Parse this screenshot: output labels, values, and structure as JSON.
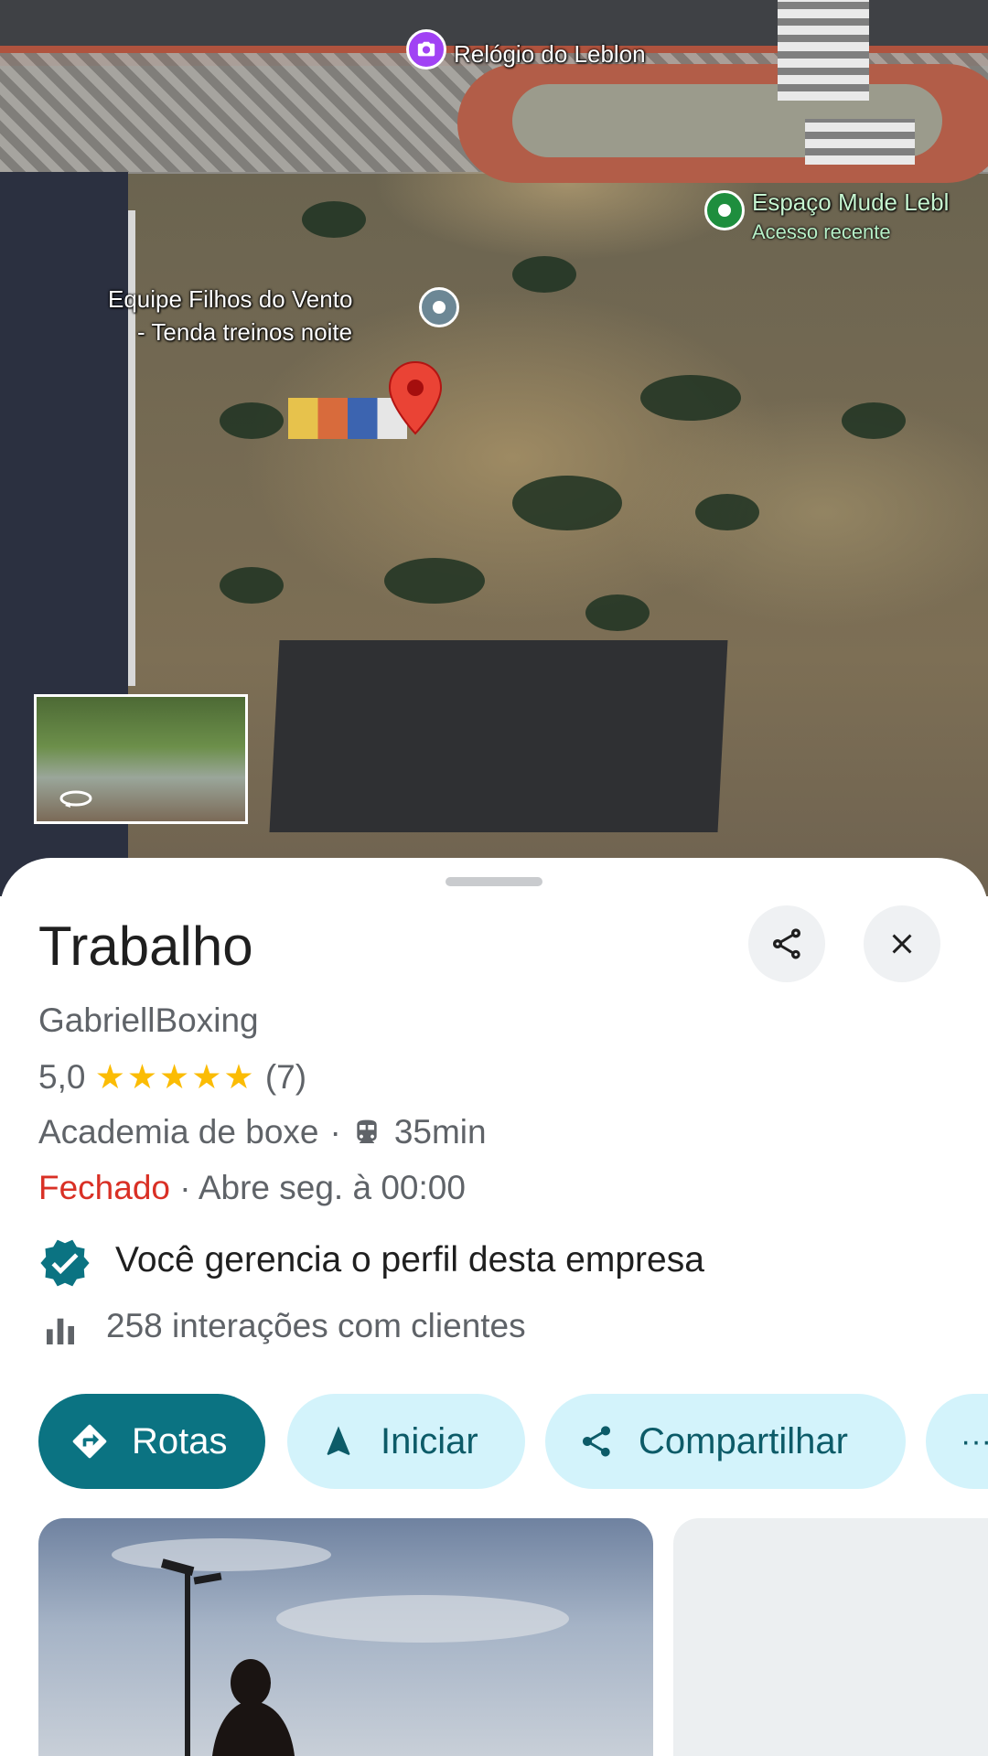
{
  "map": {
    "poi_relogio": "Relógio do Leblon",
    "poi_espaco": "Espaço Mude Lebl",
    "poi_espaco_sub": "Acesso recente",
    "poi_equipe_line1": "Equipe Filhos do Vento",
    "poi_equipe_line2": "- Tenda treinos noite"
  },
  "place": {
    "title": "Trabalho",
    "owner": "GabriellBoxing",
    "rating": "5,0",
    "stars": "★★★★★",
    "review_count": "(7)",
    "category": "Academia de boxe",
    "separator": "·",
    "transit_time": "35min",
    "status": "Fechado",
    "hours": "· Abre seg. à 00:00",
    "managed_text": "Você gerencia o perfil desta empresa",
    "interactions": "258 interações com clientes"
  },
  "actions": {
    "rotas": "Rotas",
    "iniciar": "Iniciar",
    "compartilhar": "Compartilhar",
    "more": "···"
  },
  "colors": {
    "primary_teal": "#0b7382",
    "pill_bg": "#d3f3fb",
    "star": "#fbbc04",
    "closed_red": "#d93025"
  }
}
